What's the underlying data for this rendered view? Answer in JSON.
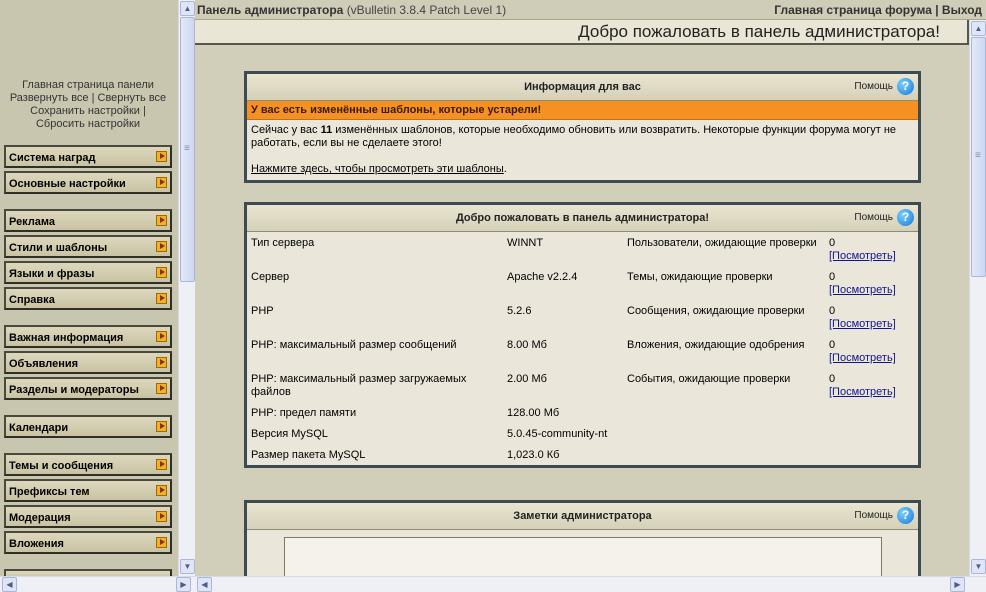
{
  "nav": {
    "links": {
      "home": "Главная страница панели",
      "expand": "Развернуть все",
      "separator": "|",
      "collapse": "Свернуть все",
      "save": "Сохранить настройки",
      "reset": "Сбросить настройки"
    },
    "items": [
      "Система наград",
      "Основные настройки",
      "Реклама",
      "Стили и шаблоны",
      "Языки и фразы",
      "Справка",
      "Важная информация",
      "Объявления",
      "Разделы и модераторы",
      "Календари",
      "Темы и сообщения",
      "Префиксы тем",
      "Модерация",
      "Вложения"
    ]
  },
  "top": {
    "title": "Панель администратора",
    "version": "(vBulletin 3.8.4 Patch Level 1)",
    "forum_home": "Главная страница форума",
    "separator": "|",
    "logout": "Выход"
  },
  "main": {
    "welcome": "Добро пожаловать в панель администратора!",
    "help_label": "Помощь",
    "info_panel": {
      "title": "Информация для вас",
      "alert": "У вас есть изменённые шаблоны, которые устарели!",
      "msg_before": "Сейчас у вас",
      "count": "11",
      "msg_after": "изменённых шаблонов, которые необходимо обновить или возвратить. Некоторые функции форума могут не работать, если вы не сделаете этого!",
      "link": "Нажмите здесь, чтобы просмотреть эти шаблоны",
      "link_end": "."
    },
    "stats_panel": {
      "title": "Добро пожаловать в панель администратора!",
      "view_label": "[Посмотреть]",
      "rows": [
        {
          "label": "Тип сервера",
          "value": "WINNT",
          "label2": "Пользователи, ожидающие проверки",
          "value2": "0"
        },
        {
          "label": "Сервер",
          "value": "Apache v2.2.4",
          "label2": "Темы, ожидающие проверки",
          "value2": "0"
        },
        {
          "label": "PHP",
          "value": "5.2.6",
          "label2": "Сообщения, ожидающие проверки",
          "value2": "0"
        },
        {
          "label": "PHP: максимальный размер сообщений",
          "value": "8.00 Мб",
          "label2": "Вложения, ожидающие одобрения",
          "value2": "0"
        },
        {
          "label": "PHP: максимальный размер загружаемых файлов",
          "value": "2.00 Мб",
          "label2": "События, ожидающие проверки",
          "value2": "0"
        },
        {
          "label": "PHP: предел памяти",
          "value": "128.00 Мб"
        },
        {
          "label": "Версия MySQL",
          "value": "5.0.45-community-nt"
        },
        {
          "label": "Размер пакета MySQL",
          "value": "1,023.0 Кб"
        }
      ]
    },
    "notes_panel": {
      "title": "Заметки администратора"
    }
  }
}
